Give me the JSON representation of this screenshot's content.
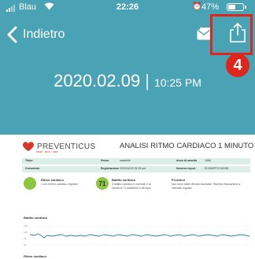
{
  "status_bar": {
    "carrier": "Blau",
    "time": "22:26",
    "battery_text": "47%",
    "battery_level": 0.47,
    "alarm_glyph": "⏰"
  },
  "nav": {
    "back_label": "Indietro"
  },
  "step_badge": "4",
  "record": {
    "date": "2020.02.09",
    "separator": "|",
    "time": "10:25 PM"
  },
  "report": {
    "brand": "PREVENTICUS",
    "brand_tagline": "heart · tech · care",
    "title": "ANALISI RITMO CARDIACO 1 MINUTO",
    "row1": [
      {
        "label": "Titolo",
        "value": ""
      },
      {
        "label": "Sesso",
        "value": "maschile"
      },
      {
        "label": "Anno di nascita",
        "value": "1965"
      }
    ],
    "row2": [
      {
        "label": "Commento",
        "value": ""
      },
      {
        "label": "Registrazione",
        "value": "2020/02/09 22:25 pm"
      },
      {
        "label": "Numero report",
        "value": "EC0D9FF3710D0B"
      }
    ],
    "summary": [
      {
        "heading": "Ritmo cardiaco",
        "text": "• con il ritmo cardiaco regolare"
      },
      {
        "score": "71",
        "heading": "Battito cardiaco",
        "text": "Il battito cardiaco è normale e la media di 71 battiti/min e 68 bpm"
      },
      {
        "heading": "Prossimi",
        "text": "Non sono state rilevate anomalie. Ripetila misurazione a intervalli regolari."
      }
    ],
    "chart_label": "Battito cardiaco",
    "chart_label_2": "Ritmo cardiaco",
    "axis_ticks": [
      "130",
      "100",
      "70",
      "40"
    ]
  },
  "colors": {
    "header_bg": "#4aa2b5",
    "highlight": "#e0251c",
    "status_ok": "#8dc63f",
    "table_row": "#dceee8"
  },
  "icons": [
    "signal-icon",
    "wifi-icon",
    "alarm-icon",
    "battery-icon",
    "chevron-left-icon",
    "message-icon",
    "share-icon",
    "heart-logo-icon"
  ]
}
